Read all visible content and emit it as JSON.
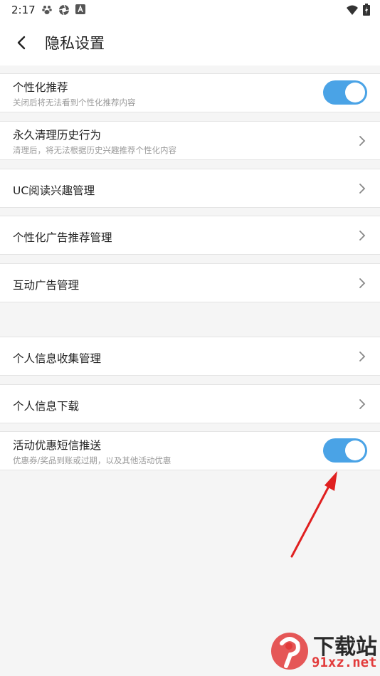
{
  "status_bar": {
    "time": "2:17"
  },
  "header": {
    "title": "隐私设置",
    "back_icon": "chevron-left-icon"
  },
  "settings": {
    "personalized_recommend": {
      "title": "个性化推荐",
      "subtitle": "关闭后将无法看到个性化推荐内容",
      "enabled": true
    },
    "clear_history": {
      "title": "永久清理历史行为",
      "subtitle": "清理后，将无法根据历史兴趣推荐个性化内容"
    },
    "uc_interest": {
      "title": "UC阅读兴趣管理"
    },
    "ad_recommend": {
      "title": "个性化广告推荐管理"
    },
    "interactive_ad": {
      "title": "互动广告管理"
    },
    "info_collect": {
      "title": "个人信息收集管理"
    },
    "info_download": {
      "title": "个人信息下载"
    },
    "sms_promo": {
      "title": "活动优惠短信推送",
      "subtitle": "优惠券/奖品到账或过期，以及其他活动优惠",
      "enabled": true
    }
  },
  "colors": {
    "toggle_on": "#4aa3e6",
    "annotation_arrow": "#e02020"
  },
  "watermark": {
    "line1": "下载站",
    "line2": "91xz.net"
  }
}
